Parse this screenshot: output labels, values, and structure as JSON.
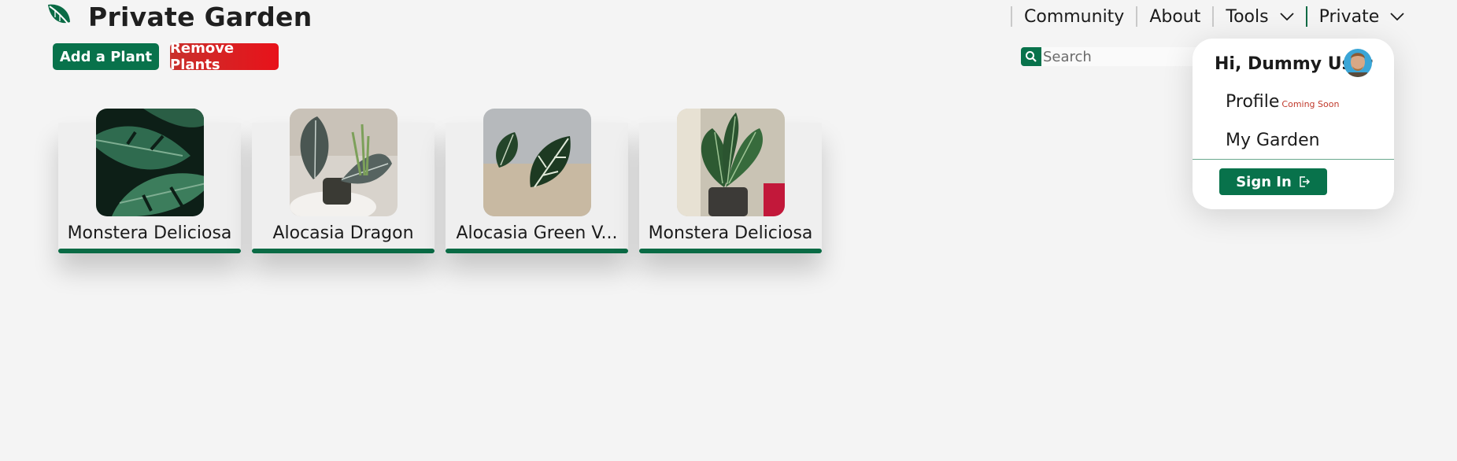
{
  "app": {
    "title": "Private Garden"
  },
  "nav": {
    "community": "Community",
    "about": "About",
    "tools": "Tools",
    "private": "Private"
  },
  "actions": {
    "add_label": "Add a Plant",
    "remove_label": "Remove Plants"
  },
  "search": {
    "placeholder": "Search",
    "peek_text": "s"
  },
  "plants": [
    {
      "name": "Monstera Deliciosa"
    },
    {
      "name": "Alocasia Dragon"
    },
    {
      "name": "Alocasia Green V..."
    },
    {
      "name": "Monstera Deliciosa"
    }
  ],
  "user_menu": {
    "greeting": "Hi, Dummy User",
    "profile_label": "Profile",
    "coming_soon": "Coming Soon",
    "garden_label": "My Garden",
    "signin_label": "Sign In"
  },
  "colors": {
    "accent": "#08724b",
    "danger": "#e8121a",
    "background": "#f4f4f4"
  }
}
